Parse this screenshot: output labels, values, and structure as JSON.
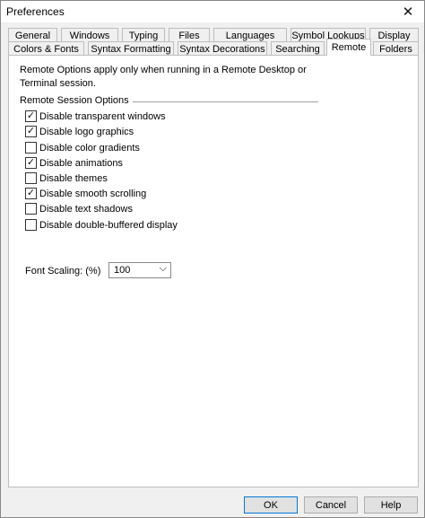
{
  "window": {
    "title": "Preferences",
    "close_glyph": "✕"
  },
  "tabs_top": [
    "General",
    "Windows",
    "Typing",
    "Files",
    "Languages",
    "Symbol Lookups",
    "Display"
  ],
  "tabs_bottom": [
    "Colors & Fonts",
    "Syntax Formatting",
    "Syntax Decorations",
    "Searching",
    "Remote",
    "Folders"
  ],
  "active_tab": "Remote",
  "info_text": "Remote Options apply only when running in a Remote Desktop or Terminal session.",
  "group_title": "Remote Session Options",
  "options": [
    {
      "label": "Disable transparent windows",
      "checked": true
    },
    {
      "label": "Disable logo graphics",
      "checked": true
    },
    {
      "label": "Disable color gradients",
      "checked": false
    },
    {
      "label": "Disable animations",
      "checked": true
    },
    {
      "label": "Disable themes",
      "checked": false
    },
    {
      "label": "Disable smooth scrolling",
      "checked": true
    },
    {
      "label": "Disable text shadows",
      "checked": false
    },
    {
      "label": "Disable double-buffered display",
      "checked": false
    }
  ],
  "font_scaling": {
    "label": "Font Scaling: (%)",
    "value": "100"
  },
  "buttons": {
    "ok": "OK",
    "cancel": "Cancel",
    "help": "Help"
  },
  "icons": {
    "checkmark": "✓",
    "dropdown": "chevron-down-icon",
    "dropdown_glyph": "⌵"
  }
}
